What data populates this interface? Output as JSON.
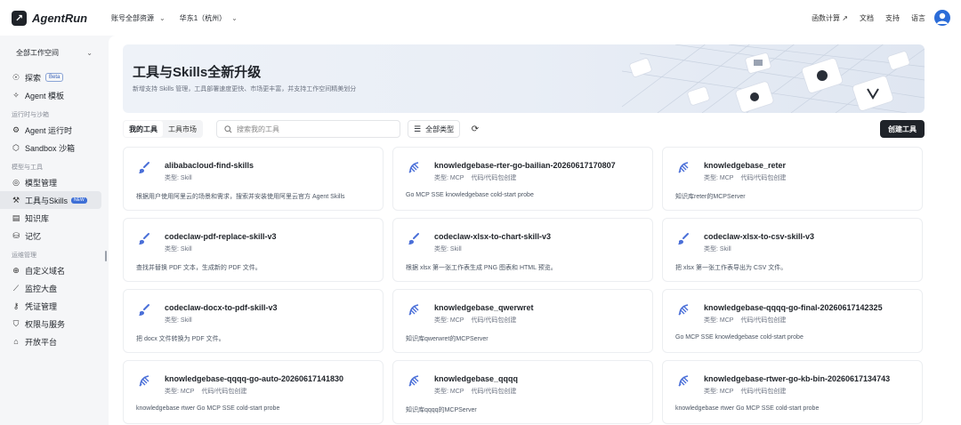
{
  "app": {
    "name": "AgentRun"
  },
  "topbar": {
    "account_scope": "账号全部资源",
    "region": "华东1（杭州）",
    "links": [
      "函数计算 ↗",
      "文档",
      "支持",
      "语言"
    ]
  },
  "sidebar": {
    "workspace": "全部工作空间",
    "groups": [
      {
        "title": "",
        "items": [
          {
            "label": "探索",
            "icon": "compass-icon",
            "badge": "Beta"
          },
          {
            "label": "Agent 模板",
            "icon": "sparkle-icon"
          }
        ]
      },
      {
        "title": "运行时与沙箱",
        "items": [
          {
            "label": "Agent 运行时",
            "icon": "runtime-icon"
          },
          {
            "label": "Sandbox 沙箱",
            "icon": "cube-icon"
          }
        ]
      },
      {
        "title": "模型与工具",
        "items": [
          {
            "label": "模型管理",
            "icon": "model-icon"
          },
          {
            "label": "工具与Skills",
            "icon": "tools-icon",
            "badge": "NEW",
            "active": true
          },
          {
            "label": "知识库",
            "icon": "book-icon"
          },
          {
            "label": "记忆",
            "icon": "memory-icon"
          }
        ]
      },
      {
        "title": "运维管理",
        "items": [
          {
            "label": "自定义域名",
            "icon": "globe-icon"
          },
          {
            "label": "监控大盘",
            "icon": "chart-icon"
          },
          {
            "label": "凭证管理",
            "icon": "key-icon"
          },
          {
            "label": "权限与服务",
            "icon": "shield-icon"
          },
          {
            "label": "开放平台",
            "icon": "platform-icon"
          }
        ]
      }
    ]
  },
  "banner": {
    "title": "工具与Skills全新升级",
    "subtitle": "新增支持 Skills 管理，工具部署速度更快、市场更丰富，并支持工作空间精美划分"
  },
  "toolbar": {
    "tabs": [
      "我的工具",
      "工具市场"
    ],
    "search_placeholder": "搜索我的工具",
    "type_filter": "全部类型",
    "create_label": "创建工具"
  },
  "tools": [
    {
      "name": "alibabacloud-find-skills",
      "type": "类型: Skill",
      "source": "",
      "desc": "根据用户使用阿里云的场景和需求，搜索并安装使用阿里云官方 Agent Skills",
      "kind": "skill"
    },
    {
      "name": "knowledgebase-rter-go-bailian-20260617170807",
      "type": "类型: MCP",
      "source": "代码/代码包创建",
      "desc": "Go MCP SSE knowledgebase cold-start probe",
      "kind": "mcp"
    },
    {
      "name": "knowledgebase_reter",
      "type": "类型: MCP",
      "source": "代码/代码包创建",
      "desc": "知识库reter的MCPServer",
      "kind": "mcp"
    },
    {
      "name": "codeclaw-pdf-replace-skill-v3",
      "type": "类型: Skill",
      "source": "",
      "desc": "查找并替换 PDF 文本，生成新的 PDF 文件。",
      "kind": "skill"
    },
    {
      "name": "codeclaw-xlsx-to-chart-skill-v3",
      "type": "类型: Skill",
      "source": "",
      "desc": "根据 xlsx 第一张工作表生成 PNG 图表和 HTML 预览。",
      "kind": "skill"
    },
    {
      "name": "codeclaw-xlsx-to-csv-skill-v3",
      "type": "类型: Skill",
      "source": "",
      "desc": "把 xlsx 第一张工作表导出为 CSV 文件。",
      "kind": "skill"
    },
    {
      "name": "codeclaw-docx-to-pdf-skill-v3",
      "type": "类型: Skill",
      "source": "",
      "desc": "把 docx 文件转换为 PDF 文件。",
      "kind": "skill"
    },
    {
      "name": "knowledgebase_qwerwret",
      "type": "类型: MCP",
      "source": "代码/代码包创建",
      "desc": "知识库qwerwret的MCPServer",
      "kind": "mcp"
    },
    {
      "name": "knowledgebase-qqqq-go-final-20260617142325",
      "type": "类型: MCP",
      "source": "代码/代码包创建",
      "desc": "Go MCP SSE knowledgebase cold-start probe",
      "kind": "mcp"
    },
    {
      "name": "knowledgebase-qqqq-go-auto-20260617141830",
      "type": "类型: MCP",
      "source": "代码/代码包创建",
      "desc": "knowledgebase rtwer Go MCP SSE cold-start probe",
      "kind": "mcp"
    },
    {
      "name": "knowledgebase_qqqq",
      "type": "类型: MCP",
      "source": "代码/代码包创建",
      "desc": "知识库qqqq的MCPServer",
      "kind": "mcp"
    },
    {
      "name": "knowledgebase-rtwer-go-kb-bin-20260617134743",
      "type": "类型: MCP",
      "source": "代码/代码包创建",
      "desc": "knowledgebase rtwer Go MCP SSE cold-start probe",
      "kind": "mcp"
    }
  ],
  "colors": {
    "accent": "#3e6fd6",
    "primary_button": "#1f2329",
    "icon_blue": "#4a6fd8"
  }
}
